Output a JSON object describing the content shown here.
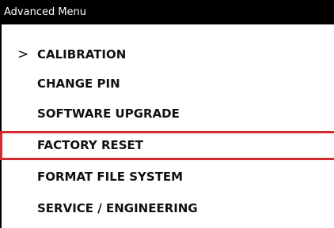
{
  "window": {
    "title": "Advanced Menu"
  },
  "menu": {
    "items": [
      {
        "label": "CALIBRATION",
        "icon": "chevron-right-icon",
        "selected": true
      },
      {
        "label": "CHANGE PIN"
      },
      {
        "label": "SOFTWARE UPGRADE"
      },
      {
        "label": "FACTORY RESET",
        "highlighted": true
      },
      {
        "label": "FORMAT FILE SYSTEM"
      },
      {
        "label": "SERVICE / ENGINEERING"
      }
    ]
  },
  "colors": {
    "title_bar_background": "#000000",
    "title_text": "#ffffff",
    "highlight_border": "#d42a2f",
    "item_text": "#111111"
  }
}
